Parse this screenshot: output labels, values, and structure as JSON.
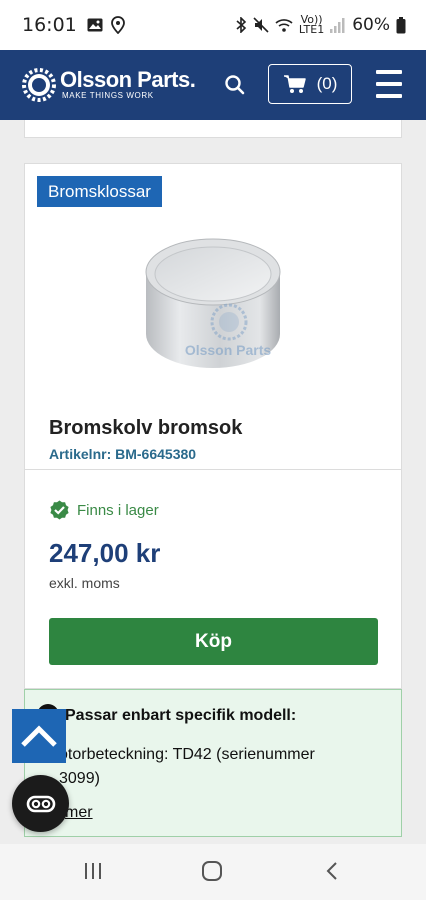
{
  "status_bar": {
    "time": "16:01",
    "network_top": "Vo))",
    "network_bottom": "LTE1",
    "battery": "60%"
  },
  "header": {
    "logo_name": "Olsson Parts.",
    "logo_tagline": "MAKE THINGS WORK",
    "cart_count": "(0)"
  },
  "product": {
    "category": "Bromsklossar",
    "image_watermark": "Olsson Parts",
    "title": "Bromskolv bromsok",
    "article": "Artikelnr: BM-6645380",
    "stock": "Finns i lager",
    "price": "247,00 kr",
    "vat_note": "exkl. moms",
    "buy_label": "Köp"
  },
  "fitment": {
    "line1": "Passar enbart specifik modell:",
    "line2": "otorbeteckning: TD42 (serienummer",
    "line3": "3099)",
    "link": "mer"
  },
  "colors": {
    "header_bg": "#1e3f78",
    "badge": "#1e66b4",
    "buy_button": "#2e8540",
    "stock_green": "#3a8a46",
    "price_blue": "#1e3f78",
    "info_bg": "#e9f6ec"
  },
  "icons": [
    "image-icon",
    "location-icon",
    "bluetooth-icon",
    "mute-icon",
    "wifi-icon",
    "signal-icon",
    "battery-icon",
    "search-icon",
    "cart-icon",
    "menu-icon",
    "check-icon",
    "chevron-up-icon",
    "chat-icon",
    "recent-apps-icon",
    "home-icon",
    "back-icon"
  ]
}
